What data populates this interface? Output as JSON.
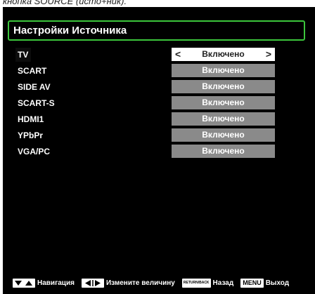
{
  "caption": "кнопка SOURCE (истo+ник).",
  "menu": {
    "title": "Настройки Источника",
    "sources": [
      {
        "name": "TV",
        "value": "Включено",
        "active": true
      },
      {
        "name": "SCART",
        "value": "Включено",
        "active": false
      },
      {
        "name": "SIDE AV",
        "value": "Включено",
        "active": false
      },
      {
        "name": "SCART-S",
        "value": "Включено",
        "active": false
      },
      {
        "name": "HDMI1",
        "value": "Включено",
        "active": false
      },
      {
        "name": "YPbPr",
        "value": "Включено",
        "active": false
      },
      {
        "name": "VGA/PC",
        "value": "Включено",
        "active": false
      }
    ],
    "left_arrow": "<",
    "right_arrow": ">"
  },
  "footer": {
    "navigate_label": "Навигация",
    "change_label": "Измените величину",
    "return_key": "RETURN/BACK",
    "back_label": "Назад",
    "menu_key": "MENU",
    "exit_label": "Выход"
  },
  "icons": [
    "up-down-nav-icon",
    "left-right-change-icon",
    "return-back-key-icon",
    "menu-key-icon"
  ],
  "colors": {
    "accent_border": "#3cc63c",
    "value_bg": "#8a8a8a",
    "active_value_bg": "#ffffff",
    "screen_bg": "#000000"
  }
}
